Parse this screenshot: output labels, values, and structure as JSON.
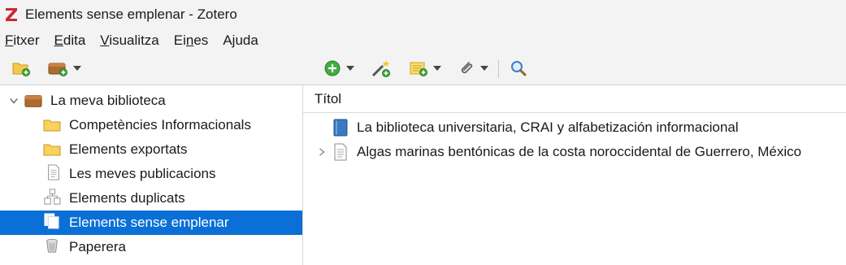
{
  "window": {
    "title": "Elements sense emplenar - Zotero",
    "app_icon": "zotero-z-logo",
    "logo_color": "#cc2936"
  },
  "menubar": {
    "items": [
      {
        "label": "Fitxer"
      },
      {
        "label": "Edita"
      },
      {
        "label": "Visualitza"
      },
      {
        "label": "Eines"
      },
      {
        "label": "Ajuda"
      }
    ]
  },
  "toolbar": {
    "buttons": [
      {
        "icon": "new-collection-icon"
      },
      {
        "icon": "new-library-icon"
      },
      {
        "icon": "new-item-icon"
      },
      {
        "icon": "magic-wand-icon"
      },
      {
        "icon": "new-note-icon"
      },
      {
        "icon": "attachment-icon"
      },
      {
        "icon": "search-icon"
      }
    ]
  },
  "sidebar": {
    "library": {
      "label": "La meva biblioteca",
      "expanded": true,
      "icon": "library-icon"
    },
    "items": [
      {
        "label": "Competències Informacionals",
        "icon": "folder-icon"
      },
      {
        "label": "Elements exportats",
        "icon": "folder-icon"
      },
      {
        "label": "Les meves publicacions",
        "icon": "document-icon"
      },
      {
        "label": "Elements duplicats",
        "icon": "duplicates-icon"
      },
      {
        "label": "Elements sense emplenar",
        "icon": "unfiled-icon",
        "selected": true
      },
      {
        "label": "Paperera",
        "icon": "trash-icon"
      }
    ],
    "selected_color": "#0a6fd6"
  },
  "items_pane": {
    "column_header": "Títol",
    "rows": [
      {
        "title": "La biblioteca universitaria, CRAI y alfabetización informacional",
        "icon": "book-icon",
        "has_children": false
      },
      {
        "title": "Algas marinas bentónicas de la costa noroccidental de Guerrero, México",
        "icon": "document-icon",
        "has_children": true
      }
    ]
  }
}
